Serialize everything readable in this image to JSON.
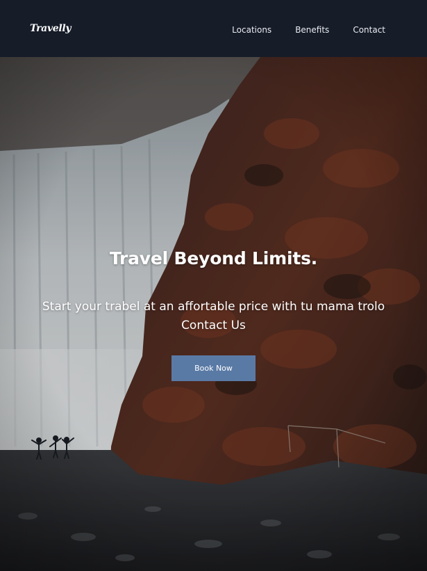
{
  "nav": {
    "brand": "Travelly",
    "links": [
      {
        "label": "Locations"
      },
      {
        "label": "Benefits"
      },
      {
        "label": "Contact"
      }
    ]
  },
  "hero": {
    "title": "Travel Beyond Limits.",
    "subtitle": "Start your trabel at an affortable price with tu mama trolo Contact Us",
    "button_label": "Book Now"
  },
  "colors": {
    "navbar_bg": "#161c28",
    "button_bg": "#5a7aa6",
    "text": "#ffffff"
  }
}
